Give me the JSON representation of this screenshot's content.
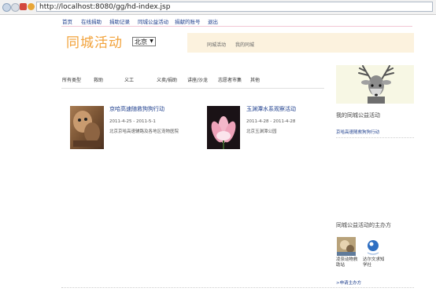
{
  "browser": {
    "url": "http://localhost:8080/gg/hd-index.jsp"
  },
  "nav": {
    "items": [
      "首页",
      "在线捐助",
      "捐助记录",
      "同城公益活动",
      "捐献的账号",
      "退出"
    ]
  },
  "header": {
    "logo": "同城活动",
    "city": "北京",
    "tabs": [
      "同城活动",
      "我的同城"
    ]
  },
  "categories": [
    "所有类型",
    "救助",
    "义工",
    "义卖/捐助",
    "讲座/沙龙",
    "志愿者市集",
    "其他"
  ],
  "events": [
    {
      "title": "京哈高速随救狗狗行动",
      "date": "2011-4-25 - 2011-5-1",
      "location": "北京京哈高速辅路及各地区宠物医院"
    },
    {
      "title": "玉渊潭水系观察活动",
      "date": "2011-4-28 - 2011-4-28",
      "location": "北京玉渊潭公园"
    }
  ],
  "sidebar": {
    "my_title": "我的同城公益活动",
    "my_link": "京哈高速随救狗狗行动",
    "org_title": "同城公益活动的主办方",
    "orgs": [
      {
        "line1": "凌奈动物救",
        "line2": "助站"
      },
      {
        "line1": "达尔文求知",
        "line2": "学社"
      }
    ],
    "apply_link": ">申请主办方"
  },
  "colors": {
    "logo": "#f2a23a",
    "link": "#1c3d8c",
    "tab_panel": "#fcf2de",
    "accent_rule": "#f3c6d3"
  }
}
